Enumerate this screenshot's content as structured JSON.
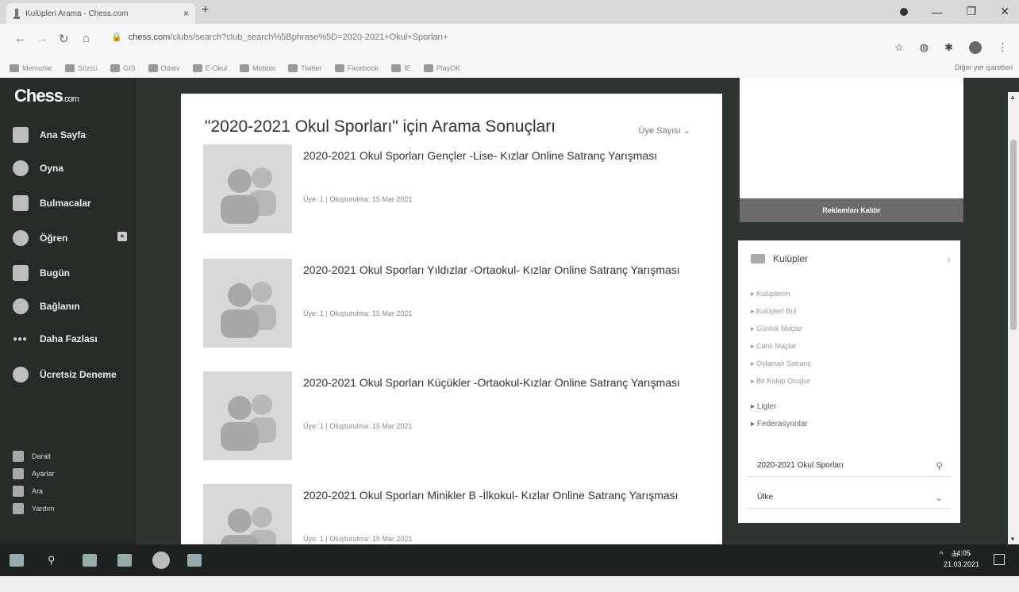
{
  "browser": {
    "tab_title": "Kulüpleri Arama - Chess.com",
    "new_tab": "+",
    "close_tab": "×",
    "url_host": "chess.com",
    "url_path": "/clubs/search?club_search%5Bphrase%5D=2020-2021+Okul+Sporları+",
    "bookmarks": [
      "Memurlar",
      "Sözcü",
      "GIS",
      "Odatv",
      "E-Okul",
      "Mebbis",
      "Twitter",
      "Facebook",
      "IE",
      "PlayOK"
    ],
    "bookmarks_right": "Diğer yer işaretleri"
  },
  "sidebar": {
    "logo": "Chess",
    "logo_suffix": ".com",
    "items": [
      {
        "label": "Ana Sayfa"
      },
      {
        "label": "Oyna"
      },
      {
        "label": "Bulmacalar"
      },
      {
        "label": "Öğren"
      },
      {
        "label": "Bugün"
      },
      {
        "label": "Bağlanın"
      },
      {
        "label": "Daha Fazlası"
      },
      {
        "label": "Ücretsiz Deneme"
      }
    ],
    "footer": [
      {
        "label": "Daralt"
      },
      {
        "label": "Ayarlar"
      },
      {
        "label": "Ara"
      },
      {
        "label": "Yardım"
      }
    ]
  },
  "main": {
    "title": "\"2020-2021 Okul Sporları\" için Arama Sonuçları",
    "sort_label": "Üye Sayısı ⌄",
    "results": [
      {
        "title": "2020-2021 Okul Sporları Gençler -Lise- Kızlar Online Satranç Yarışması",
        "meta": "Üye: 1 | Oluşturulma: 15 Mar 2021"
      },
      {
        "title": "2020-2021 Okul Sporları Yıldızlar -Ortaokul- Kızlar Online Satranç Yarışması",
        "meta": "Üye: 1 | Oluşturulma: 15 Mar 2021"
      },
      {
        "title": "2020-2021 Okul Sporları Küçükler -Ortaokul-Kızlar Online Satranç Yarışması",
        "meta": "Üye: 1 | Oluşturulma: 15 Mar 2021"
      },
      {
        "title": "2020-2021 Okul Sporları Minikler B -İlkokul- Kızlar Online Satranç Yarışması",
        "meta": "Üye: 1 | Oluşturulma: 15 Mar 2021"
      }
    ]
  },
  "right": {
    "remove_ads": "Reklamları Kaldır",
    "clubs_title": "Kulüpler",
    "links": [
      "Kulüplerim",
      "Kulüpleri Bul",
      "Günlük Maçlar",
      "Canlı Maçlar",
      "Oylamalı Satranç",
      "Bir Kulüp Oluştur"
    ],
    "links2": [
      "Ligler",
      "Federasyonlar"
    ],
    "search_value": "2020-2021 Okul Sporları",
    "country_label": "Ülke"
  },
  "taskbar": {
    "time": "14:05",
    "date": "21.03.2021"
  }
}
